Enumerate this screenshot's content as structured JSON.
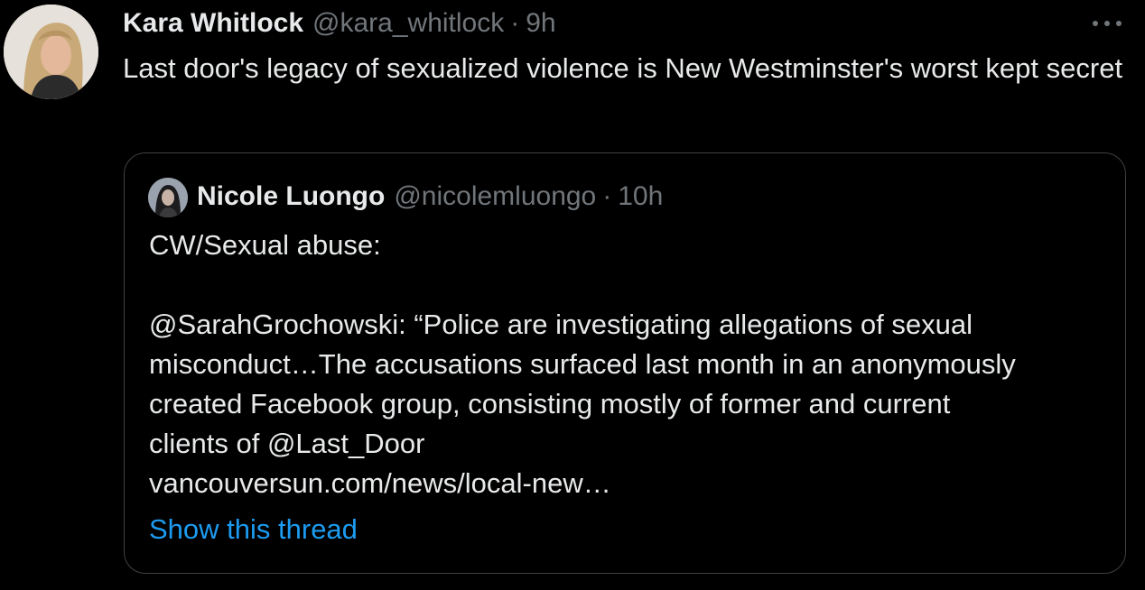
{
  "tweet": {
    "author_name": "Kara Whitlock",
    "author_handle": "@kara_whitlock",
    "separator": "·",
    "time": "9h",
    "text": "Last door's legacy of sexualized violence is New Westminster's worst kept secret",
    "more_icon": "more-horizontal-icon"
  },
  "quote": {
    "author_name": "Nicole Luongo",
    "author_handle": "@nicolemluongo",
    "separator": "·",
    "time": "10h",
    "lines": [
      "CW/Sexual abuse:",
      "",
      "@SarahGrochowski: “Police are investigating allegations of sexual",
      "misconduct…The accusations surfaced last month in an anonymously",
      "created Facebook group, consisting mostly of former and current",
      "clients of @Last_Door",
      "vancouversun.com/news/local-new…"
    ],
    "show_thread_label": "Show this thread"
  },
  "colors": {
    "background": "#000000",
    "text_primary": "#e7e9ea",
    "text_secondary": "#71767b",
    "link": "#1d9bf0",
    "border": "#3e4144"
  }
}
